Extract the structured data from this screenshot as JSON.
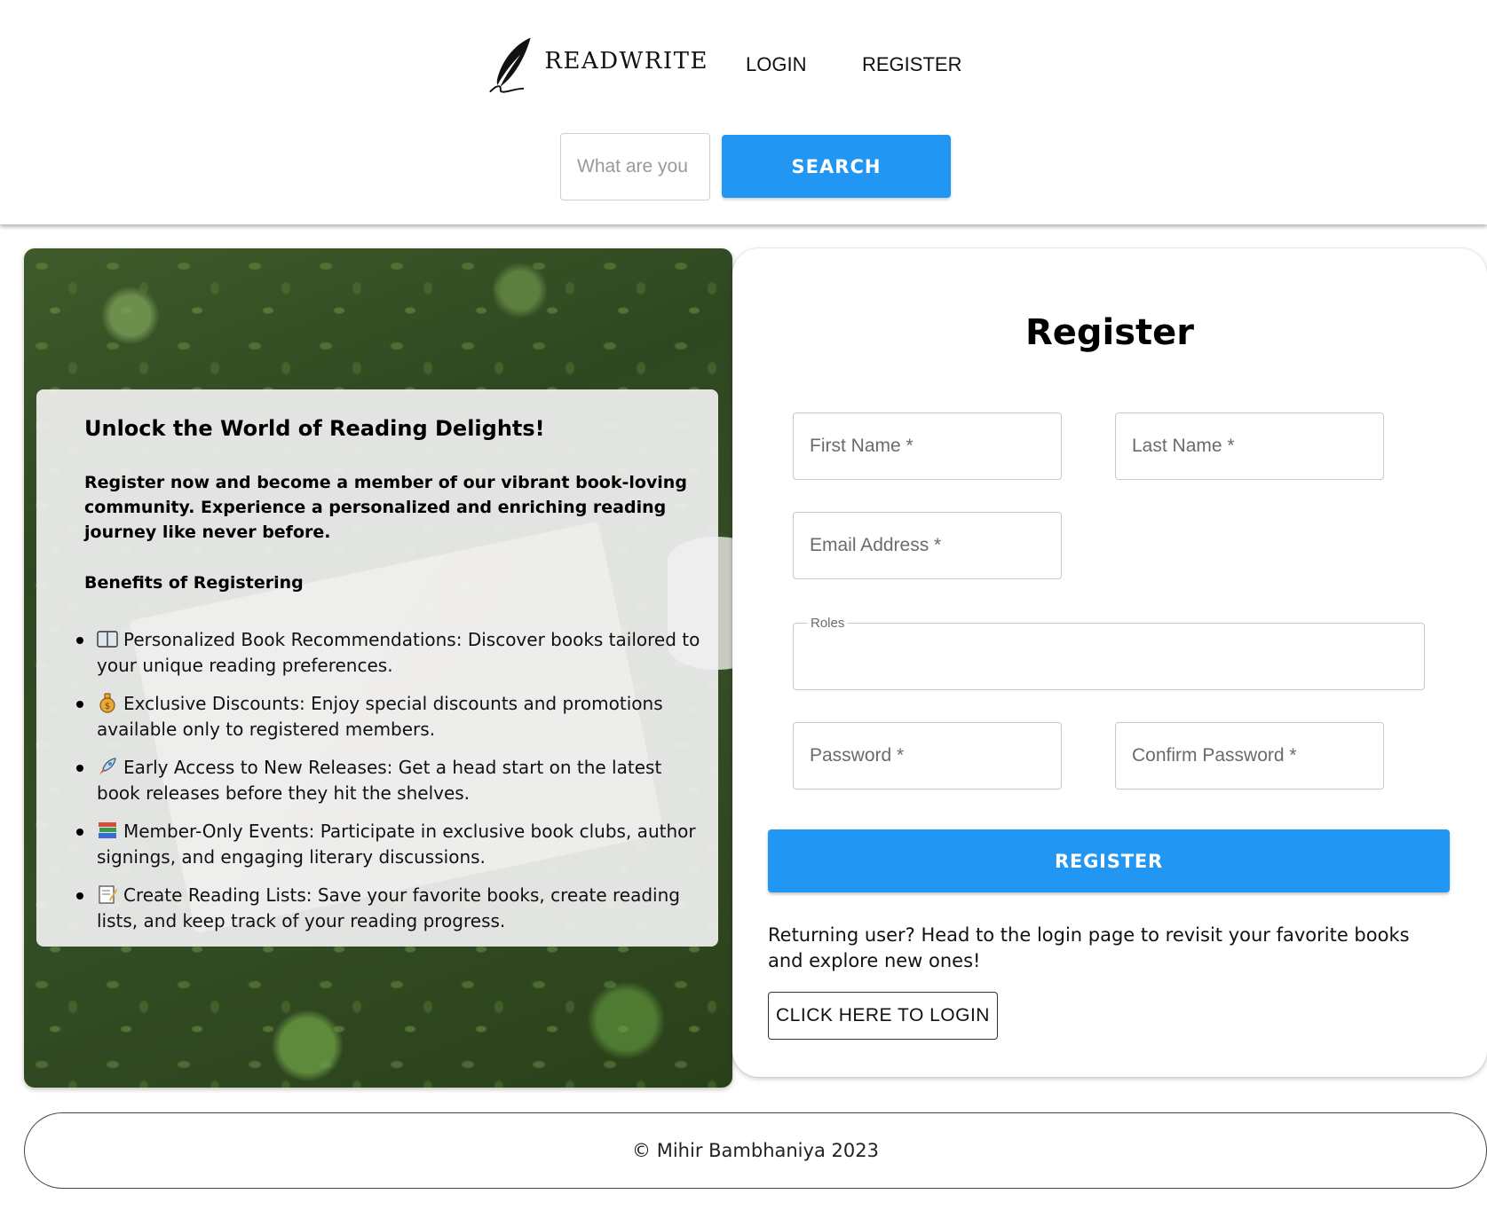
{
  "header": {
    "brand": "READWRITE",
    "nav": {
      "login": "LOGIN",
      "register": "REGISTER"
    },
    "search": {
      "placeholder": "What are you",
      "button": "SEARCH"
    }
  },
  "info": {
    "title": "Unlock the World of Reading Delights!",
    "intro": "Register now and become a member of our vibrant book-loving community. Experience a personalized and enriching reading journey like never before.",
    "benefits_heading": "Benefits of Registering",
    "benefits": [
      {
        "icon": "open-book-icon",
        "text": "Personalized Book Recommendations: Discover books tailored to your unique reading preferences."
      },
      {
        "icon": "money-bag-icon",
        "text": "Exclusive Discounts: Enjoy special discounts and promotions available only to registered members."
      },
      {
        "icon": "rocket-icon",
        "text": "Early Access to New Releases: Get a head start on the latest book releases before they hit the shelves."
      },
      {
        "icon": "books-icon",
        "text": "Member-Only Events: Participate in exclusive book clubs, author signings, and engaging literary discussions."
      },
      {
        "icon": "memo-icon",
        "text": "Create Reading Lists: Save your favorite books, create reading lists, and keep track of your reading progress."
      }
    ]
  },
  "register": {
    "title": "Register",
    "fields": {
      "first_name": {
        "placeholder": "First Name *",
        "value": ""
      },
      "last_name": {
        "placeholder": "Last Name *",
        "value": ""
      },
      "email": {
        "placeholder": "Email Address *",
        "value": ""
      },
      "roles": {
        "label": "Roles",
        "value": ""
      },
      "password": {
        "placeholder": "Password *",
        "value": ""
      },
      "confirm_password": {
        "placeholder": "Confirm Password *",
        "value": ""
      }
    },
    "submit": "REGISTER",
    "returning_text": "Returning user? Head to the login page to revisit your favorite books and explore new ones!",
    "login_button": "CLICK HERE TO LOGIN"
  },
  "footer": {
    "text": "© Mihir Bambhaniya 2023"
  },
  "colors": {
    "primary": "#2196f3",
    "card_bg": "#ffffff",
    "info_bg": "#f0f0f0"
  }
}
